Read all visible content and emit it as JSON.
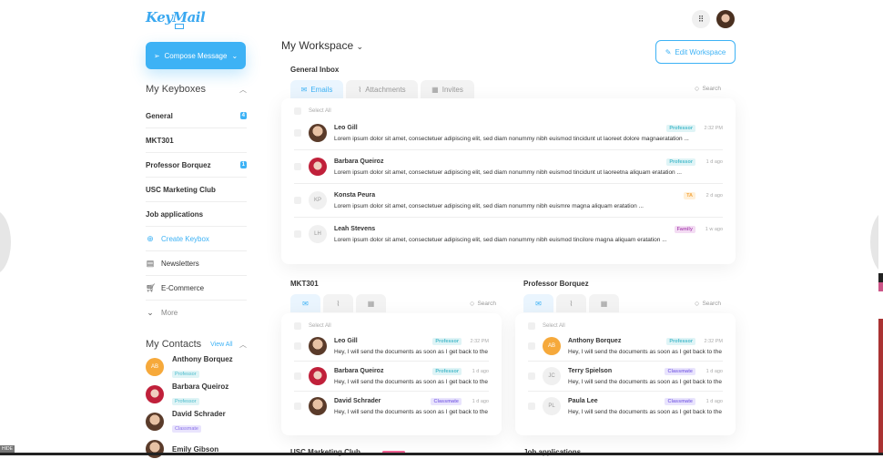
{
  "logo": "KeyMail",
  "compose_label": "Compose Message",
  "keyboxes": {
    "heading": "My Keyboxes",
    "items": [
      {
        "label": "General",
        "badge": "4"
      },
      {
        "label": "MKT301",
        "badge": ""
      },
      {
        "label": "Professor Borquez",
        "badge": "1"
      },
      {
        "label": "USC Marketing Club",
        "badge": ""
      },
      {
        "label": "Job applications",
        "badge": ""
      }
    ],
    "create": "Create Keybox",
    "newsletters": "Newsletters",
    "ecommerce": "E-Commerce",
    "more": "More"
  },
  "contacts": {
    "heading": "My Contacts",
    "view_all": "View All",
    "items": [
      {
        "name": "Anthony Borquez",
        "tag": "Professor",
        "initials": "AB",
        "av": "orange"
      },
      {
        "name": "Barbara Queiroz",
        "tag": "Professor",
        "initials": "",
        "av": "red"
      },
      {
        "name": "David Schrader",
        "tag": "Classmate",
        "initials": "",
        "av": "photo"
      },
      {
        "name": "Emily Gibson",
        "tag": "",
        "initials": "",
        "av": "photo"
      }
    ]
  },
  "workspace": {
    "title": "My Workspace",
    "edit": "Edit Workspace"
  },
  "general": {
    "title": "General Inbox",
    "tabs": [
      "Emails",
      "Attachments",
      "Invites"
    ],
    "search": "Search",
    "select_all": "Select All",
    "rows": [
      {
        "name": "Leo Gill",
        "tag": "Professor",
        "time": "2:32 PM",
        "initials": "",
        "av": "photo",
        "preview": "Lorem ipsum dolor sit amet, consectetuer adipiscing elit, sed diam nonummy nibh euismod tincidunt ut laoreet dolore magnaeratation ..."
      },
      {
        "name": "Barbara Queiroz",
        "tag": "Professor",
        "time": "1 d ago",
        "initials": "",
        "av": "red",
        "preview": "Lorem ipsum dolor sit amet, consectetuer adipiscing elit, sed diam nonummy nibh euismod tincidunt ut laoreetna aliquam eratation ..."
      },
      {
        "name": "Konsta Peura",
        "tag": "TA",
        "time": "2 d ago",
        "initials": "KP",
        "av": "",
        "preview": "Lorem ipsum dolor sit amet, consectetuer adipiscing elit, sed diam nonummy nibh euismre magna aliquam eratation ..."
      },
      {
        "name": "Leah Stevens",
        "tag": "Family",
        "time": "1 w ago",
        "initials": "LH",
        "av": "",
        "preview": "Lorem ipsum dolor sit amet, consectetuer adipiscing elit, sed diam nonummy nibh euismod tincilore magna aliquam eratation ..."
      }
    ]
  },
  "mkt": {
    "title": "MKT301",
    "search": "Search",
    "select_all": "Select All",
    "rows": [
      {
        "name": "Leo Gill",
        "tag": "Professor",
        "time": "2:32 PM",
        "initials": "",
        "av": "photo",
        "preview": "Hey, I will send the documents as soon as I get back to the ..."
      },
      {
        "name": "Barbara Queiroz",
        "tag": "Professor",
        "time": "1 d ago",
        "initials": "",
        "av": "red",
        "preview": "Hey, I will send the documents as soon as I get back to the ..."
      },
      {
        "name": "David Schrader",
        "tag": "Classmate",
        "time": "1 d ago",
        "initials": "",
        "av": "photo",
        "preview": "Hey, I will send the documents as soon as I get back to the ..."
      }
    ]
  },
  "prof": {
    "title": "Professor Borquez",
    "search": "Search",
    "select_all": "Select All",
    "rows": [
      {
        "name": "Anthony Borquez",
        "tag": "Professor",
        "time": "2:32 PM",
        "initials": "AB",
        "av": "orange",
        "preview": "Hey, I will send the documents as soon as I get back to the ..."
      },
      {
        "name": "Terry Spielson",
        "tag": "Classmate",
        "time": "1 d ago",
        "initials": "JC",
        "av": "",
        "preview": "Hey, I will send the documents as soon as I get back to the ..."
      },
      {
        "name": "Paula Lee",
        "tag": "Classmate",
        "time": "1 d ago",
        "initials": "PL",
        "av": "",
        "preview": "Hey, I will send the documents as soon as I get back to the ..."
      }
    ]
  },
  "bottom": {
    "usc": "USC Marketing Club",
    "jobs": "Job applications"
  },
  "hide_label": "HIDE",
  "colors": {
    "accent": "#3db2f5"
  }
}
